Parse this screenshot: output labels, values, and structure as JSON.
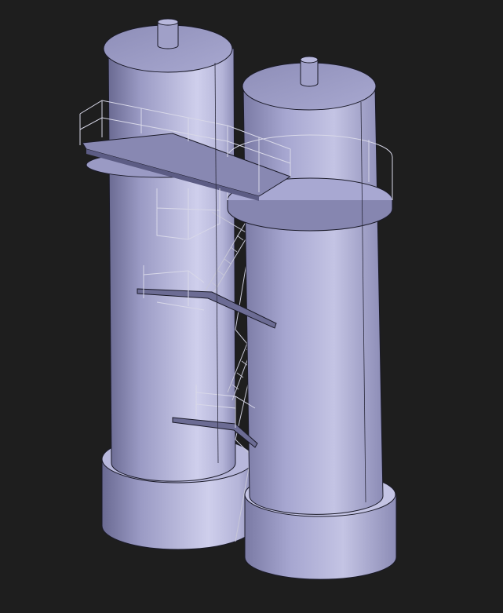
{
  "scene": {
    "subject": "twin-tower-cad-model",
    "colors": {
      "background": "#1e1e1e",
      "tower_light": "#d4d4ee",
      "tower_mid": "#a4a4cc",
      "tower_dark": "#5c5c84",
      "edge": "#1a1a28",
      "railing": "#d8d8e8"
    }
  }
}
